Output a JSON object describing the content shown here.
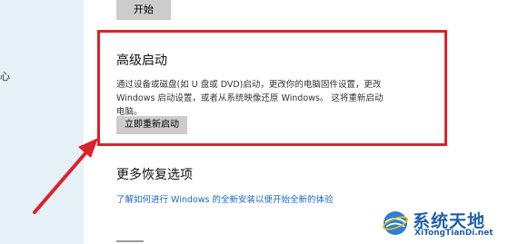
{
  "sidebar": {
    "partial_glyph": "心"
  },
  "top": {
    "start_label": "开始"
  },
  "advanced_startup": {
    "title": "高级启动",
    "description": "通过设备或磁盘(如 U 盘或 DVD)启动，更改你的电脑固件设置，更改 Windows 启动设置，或者从系统映像还原 Windows。 这将重新启动电脑。",
    "restart_label": "立即重新启动"
  },
  "more_recovery": {
    "title": "更多恢复选项",
    "link": "了解如何进行 Windows 的全新安装以便开始全新的体验"
  },
  "watermark": {
    "name": "系统天地",
    "url": "XiTongTianDi.net"
  },
  "colors": {
    "highlight": "#d9232d",
    "link": "#1a67c4",
    "sidebar": "#e6f0f7",
    "button": "#cccccc"
  }
}
